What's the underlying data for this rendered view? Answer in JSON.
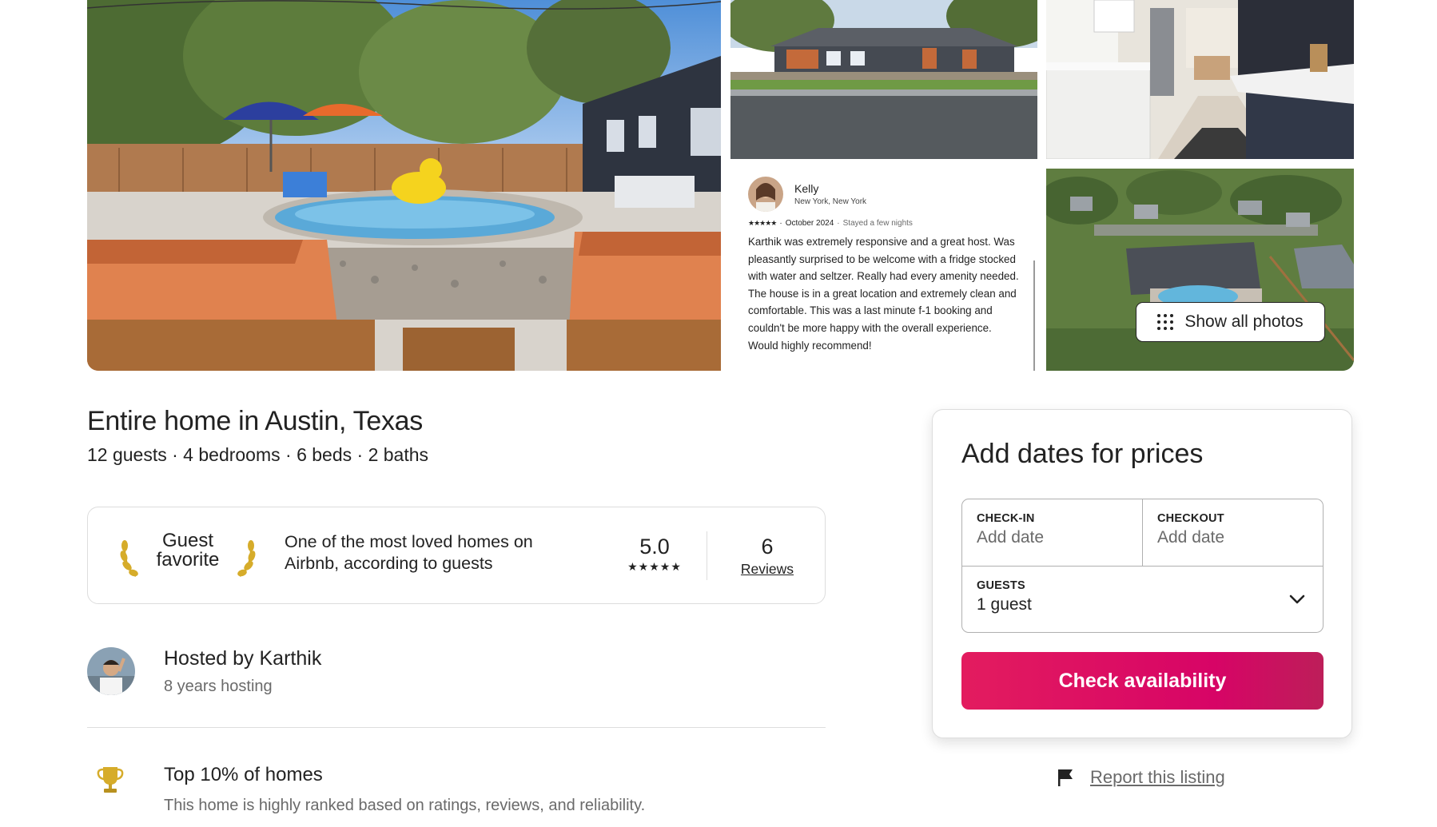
{
  "gallery": {
    "photos": [
      {
        "name": "backyard pool"
      },
      {
        "name": "house exterior"
      },
      {
        "name": "kitchen"
      },
      {
        "name": "aerial view"
      }
    ],
    "show_all_label": "Show all photos"
  },
  "review_card": {
    "reviewer_name": "Kelly",
    "reviewer_location": "New York, New York",
    "stars": "★★★★★",
    "date": "October 2024",
    "stay_note": "Stayed a few nights",
    "text": "Karthik was extremely responsive and a great host. Was pleasantly surprised to be welcome with a fridge stocked with water and seltzer. Really had every amenity needed. The house is in a great location and extremely clean and comfortable. This was a last minute f-1 booking and couldn't be more happy with the overall experience. Would highly recommend!"
  },
  "listing": {
    "title": "Entire home in Austin, Texas",
    "subtitle": "12 guests · 4 bedrooms · 6 beds · 2 baths"
  },
  "guest_favorite": {
    "label_line1": "Guest",
    "label_line2": "favorite",
    "description": "One of the most loved homes on Airbnb, according to guests",
    "rating": "5.0",
    "stars": "★★★★★",
    "review_count": "6",
    "reviews_label": "Reviews"
  },
  "host": {
    "name": "Hosted by Karthik",
    "years": "8 years hosting"
  },
  "highlight": {
    "title": "Top 10% of homes",
    "description": "This home is highly ranked based on ratings, reviews, and reliability."
  },
  "booking": {
    "title": "Add dates for prices",
    "checkin_label": "CHECK-IN",
    "checkin_value": "Add date",
    "checkout_label": "CHECKOUT",
    "checkout_value": "Add date",
    "guests_label": "GUESTS",
    "guests_value": "1 guest",
    "button_label": "Check availability",
    "button_color": "#e31c5f"
  },
  "report": {
    "label": "Report this listing"
  }
}
